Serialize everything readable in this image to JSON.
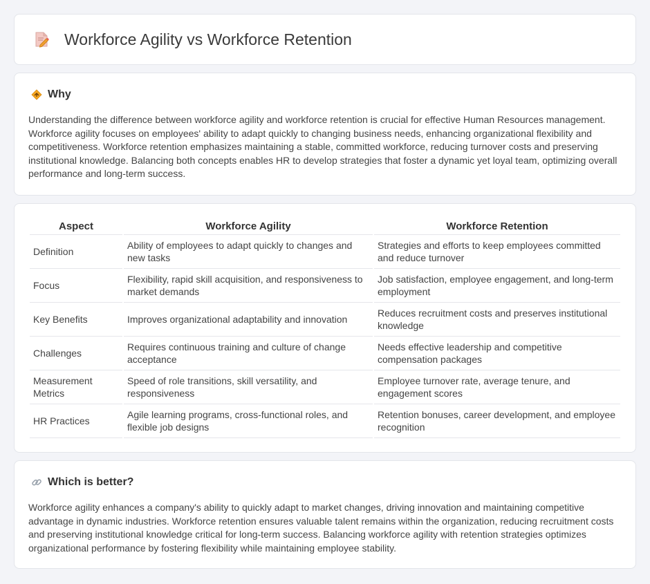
{
  "header": {
    "title": "Workforce Agility vs Workforce Retention",
    "icon": "document-pencil-icon"
  },
  "why": {
    "title": "Why",
    "icon": "diamond-sign-icon",
    "text": "Understanding the difference between workforce agility and workforce retention is crucial for effective Human Resources management. Workforce agility focuses on employees' ability to adapt quickly to changing business needs, enhancing organizational flexibility and competitiveness. Workforce retention emphasizes maintaining a stable, committed workforce, reducing turnover costs and preserving institutional knowledge. Balancing both concepts enables HR to develop strategies that foster a dynamic yet loyal team, optimizing overall performance and long-term success."
  },
  "table": {
    "headers": [
      "Aspect",
      "Workforce Agility",
      "Workforce Retention"
    ],
    "rows": [
      [
        "Definition",
        "Ability of employees to adapt quickly to changes and new tasks",
        "Strategies and efforts to keep employees committed and reduce turnover"
      ],
      [
        "Focus",
        "Flexibility, rapid skill acquisition, and responsiveness to market demands",
        "Job satisfaction, employee engagement, and long-term employment"
      ],
      [
        "Key Benefits",
        "Improves organizational adaptability and innovation",
        "Reduces recruitment costs and preserves institutional knowledge"
      ],
      [
        "Challenges",
        "Requires continuous training and culture of change acceptance",
        "Needs effective leadership and competitive compensation packages"
      ],
      [
        "Measurement Metrics",
        "Speed of role transitions, skill versatility, and responsiveness",
        "Employee turnover rate, average tenure, and engagement scores"
      ],
      [
        "HR Practices",
        "Agile learning programs, cross-functional roles, and flexible job designs",
        "Retention bonuses, career development, and employee recognition"
      ]
    ]
  },
  "better": {
    "title": "Which is better?",
    "icon": "link-icon",
    "text": "Workforce agility enhances a company's ability to quickly adapt to market changes, driving innovation and maintaining competitive advantage in dynamic industries. Workforce retention ensures valuable talent remains within the organization, reducing recruitment costs and preserving institutional knowledge critical for long-term success. Balancing workforce agility with retention strategies optimizes organizational performance by fostering flexibility while maintaining employee stability."
  }
}
